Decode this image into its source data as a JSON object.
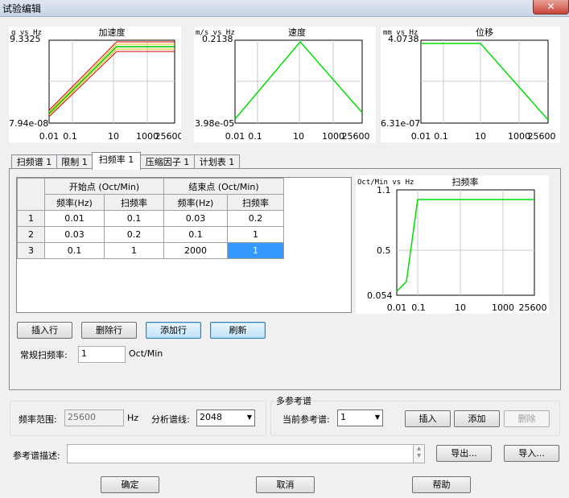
{
  "window": {
    "title": "试验编辑",
    "close_glyph": "✕"
  },
  "charts": [
    {
      "id": "acceleration",
      "ylabel": "g vs Hz",
      "title": "加速度",
      "ymax_label": "9.3325",
      "ymin_label": "7.94e-08",
      "xticks": [
        "0.01",
        "0.1",
        "10",
        "1000",
        "25600"
      ]
    },
    {
      "id": "velocity",
      "ylabel": "m/s vs Hz",
      "title": "速度",
      "ymax_label": "0.2138",
      "ymin_label": "3.98e-05",
      "xticks": [
        "0.01",
        "0.1",
        "10",
        "1000",
        "25600"
      ]
    },
    {
      "id": "displacement",
      "ylabel": "mm vs Hz",
      "title": "位移",
      "ymax_label": "4.0738",
      "ymin_label": "6.31e-07",
      "xticks": [
        "0.01",
        "0.1",
        "10",
        "1000",
        "25600"
      ]
    },
    {
      "id": "sweep-rate",
      "ylabel": "Oct/Min vs Hz",
      "title": "扫频率",
      "ymax_label": "1.1",
      "ymid_label": "0.5",
      "ymin_label": "0.054",
      "xticks": [
        "0.01",
        "0.1",
        "10",
        "1000",
        "25600"
      ]
    }
  ],
  "tabs": [
    {
      "label": "扫频谱 1",
      "active": false
    },
    {
      "label": "限制 1",
      "active": false
    },
    {
      "label": "扫频率 1",
      "active": true
    },
    {
      "label": "压缩因子 1",
      "active": false
    },
    {
      "label": "计划表 1",
      "active": false
    }
  ],
  "table": {
    "group_start": "开始点 (Oct/Min)",
    "group_end": "结束点 (Oct/Min)",
    "col_freq": "频率(Hz)",
    "col_rate": "扫频率",
    "rows": [
      {
        "index": "1",
        "start_freq": "0.01",
        "start_rate": "0.1",
        "end_freq": "0.03",
        "end_rate": "0.2"
      },
      {
        "index": "2",
        "start_freq": "0.03",
        "start_rate": "0.2",
        "end_freq": "0.1",
        "end_rate": "1"
      },
      {
        "index": "3",
        "start_freq": "0.1",
        "start_rate": "1",
        "end_freq": "2000",
        "end_rate": "1"
      }
    ]
  },
  "buttons": {
    "insert_row": "插入行",
    "delete_row": "删除行",
    "add_row": "添加行",
    "refresh": "刷新",
    "insert": "插入",
    "add": "添加",
    "delete": "删除",
    "export": "导出...",
    "import": "导入...",
    "ok": "确定",
    "cancel": "取消",
    "help": "帮助"
  },
  "normal_sweep": {
    "label": "常规扫频率:",
    "value": "1",
    "unit": "Oct/Min"
  },
  "freq_range": {
    "label": "频率范围:",
    "value": "25600",
    "unit": "Hz"
  },
  "analysis_lines": {
    "label": "分析谱线:",
    "value": "2048"
  },
  "multi_ref": {
    "group_title": "多参考谱",
    "current_label": "当前参考谱:",
    "current_value": "1"
  },
  "ref_desc": {
    "label": "参考谱描述:",
    "value": ""
  }
}
